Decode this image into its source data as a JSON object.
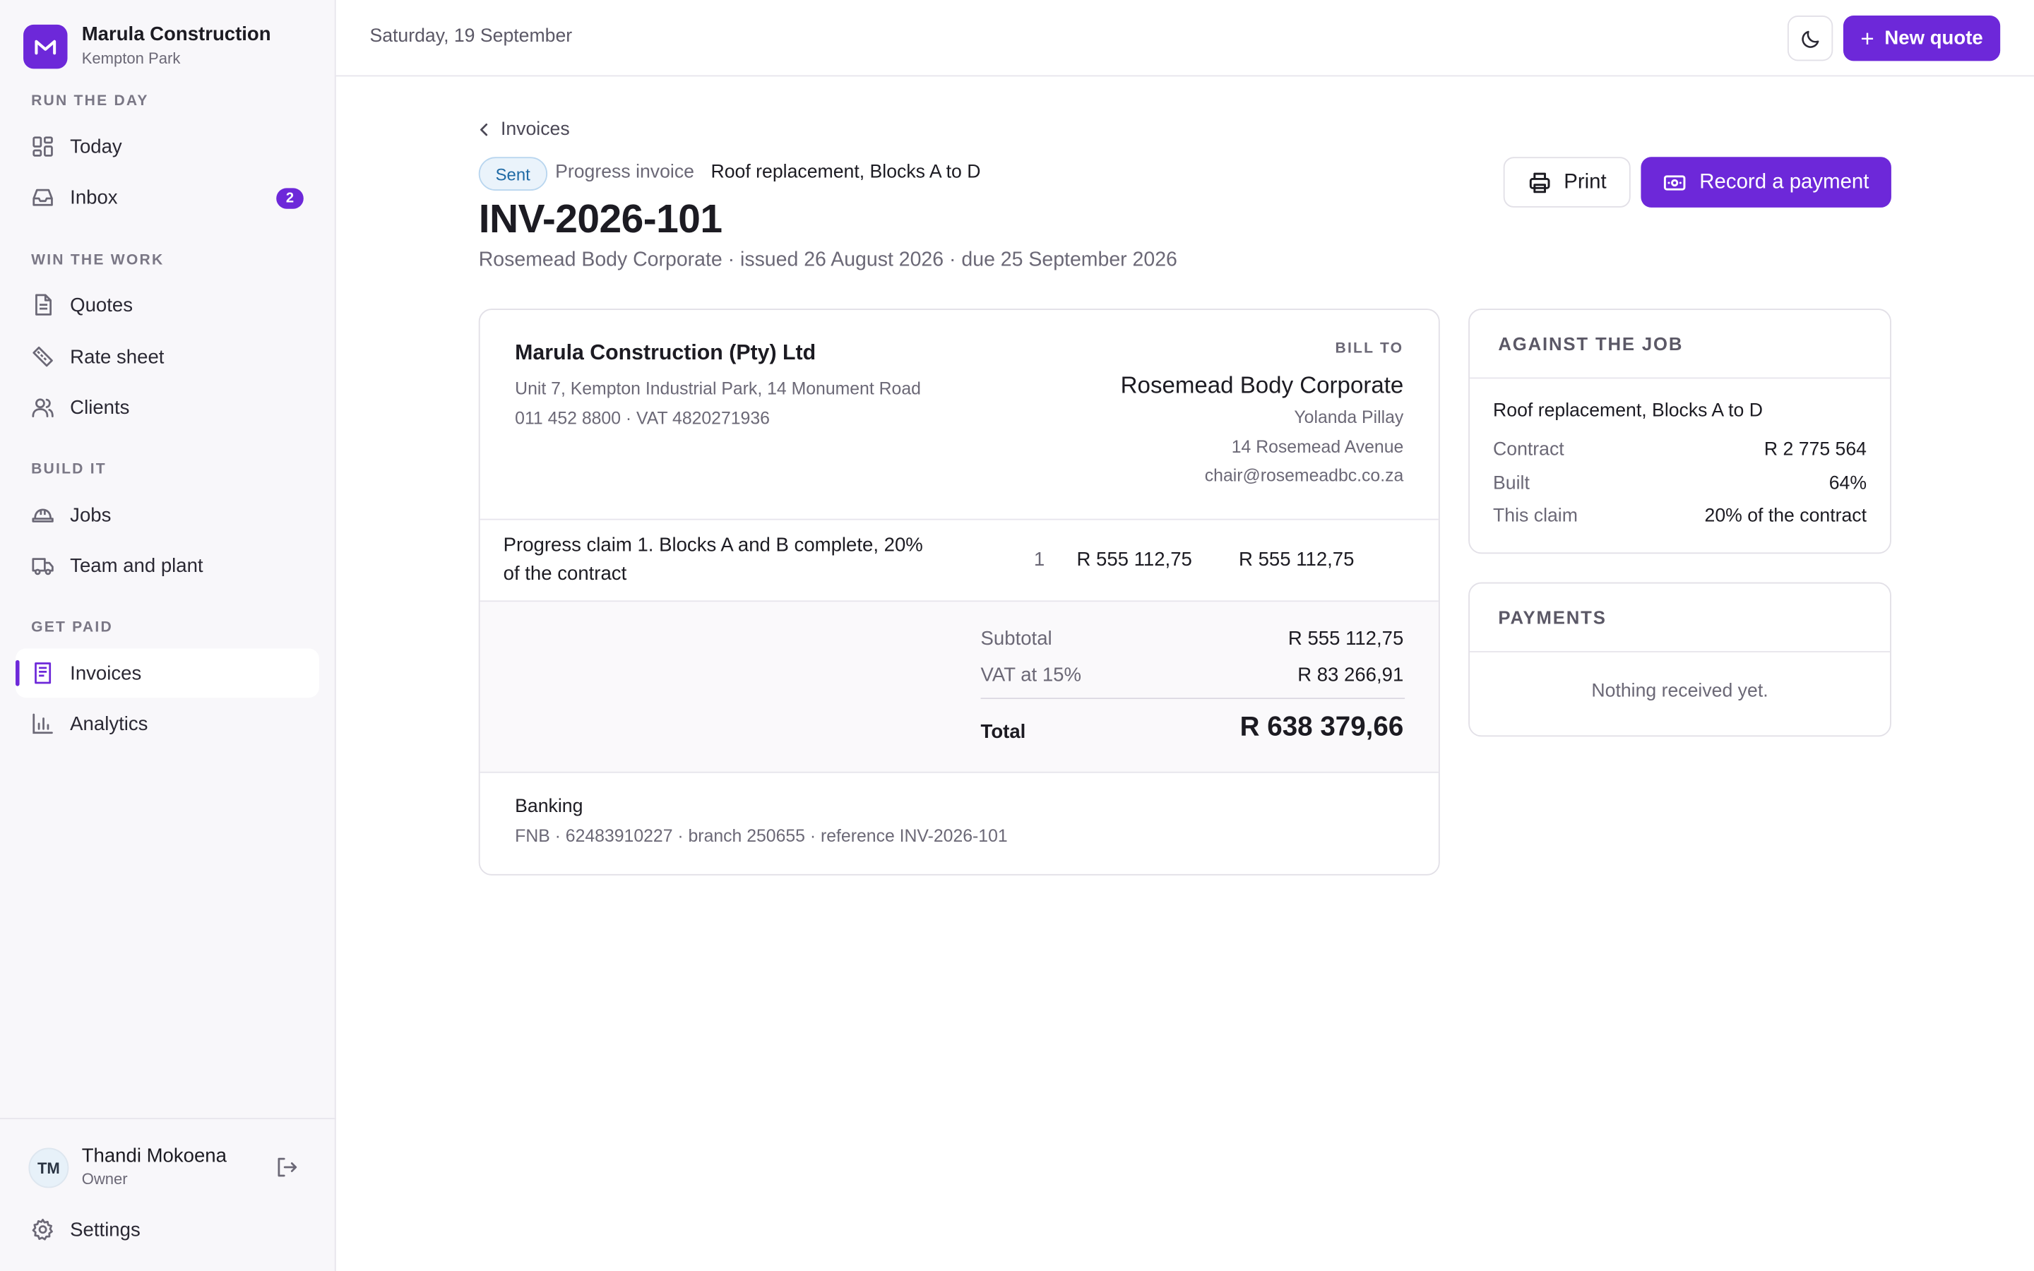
{
  "brand": {
    "name": "Marula Construction",
    "location": "Kempton Park",
    "logo_letter": "M"
  },
  "sidebar": {
    "sections": [
      {
        "label": "RUN THE DAY"
      },
      {
        "label": "WIN THE WORK"
      },
      {
        "label": "BUILD IT"
      },
      {
        "label": "GET PAID"
      }
    ],
    "items": [
      {
        "label": "Today",
        "icon": "dashboard-icon"
      },
      {
        "label": "Inbox",
        "icon": "inbox-icon",
        "badge": "2"
      },
      {
        "label": "Quotes",
        "icon": "document-icon"
      },
      {
        "label": "Rate sheet",
        "icon": "ruler-icon"
      },
      {
        "label": "Clients",
        "icon": "users-icon"
      },
      {
        "label": "Jobs",
        "icon": "hard-hat-icon"
      },
      {
        "label": "Team and plant",
        "icon": "truck-icon"
      },
      {
        "label": "Invoices",
        "icon": "invoice-icon",
        "active": true
      },
      {
        "label": "Analytics",
        "icon": "bar-chart-icon"
      }
    ],
    "user": {
      "initials": "TM",
      "name": "Thandi Mokoena",
      "role": "Owner"
    },
    "settings_label": "Settings"
  },
  "topbar": {
    "date": "Saturday, 19 September",
    "new_quote_label": "New quote"
  },
  "invoice": {
    "breadcrumb": "Invoices",
    "status": "Sent",
    "type": "Progress invoice",
    "job": "Roof replacement, Blocks A to D",
    "number": "INV-2026-101",
    "subtitle": "Rosemead Body Corporate · issued 26 August 2026 · due 25 September 2026",
    "print_label": "Print",
    "record_payment_label": "Record a payment",
    "from": {
      "name": "Marula Construction (Pty) Ltd",
      "address": "Unit 7, Kempton Industrial Park, 14 Monument Road",
      "contact": "011 452 8800 · VAT 4820271936"
    },
    "bill_to": {
      "label": "BILL TO",
      "name": "Rosemead Body Corporate",
      "contact": "Yolanda Pillay",
      "street": "14 Rosemead Avenue",
      "email": "chair@rosemeadbc.co.za"
    },
    "line_items": [
      {
        "description": "Progress claim 1. Blocks A and B complete, 20% of the contract",
        "qty": "1",
        "unit_price": "R 555 112,75",
        "amount": "R 555 112,75"
      }
    ],
    "totals": {
      "subtotal_label": "Subtotal",
      "subtotal": "R 555 112,75",
      "vat_label": "VAT at 15%",
      "vat": "R 83 266,91",
      "total_label": "Total",
      "total": "R 638 379,66"
    },
    "banking": {
      "label": "Banking",
      "details": "FNB · 62483910227 · branch 250655 · reference INV-2026-101"
    }
  },
  "against_job": {
    "heading": "AGAINST THE JOB",
    "title": "Roof replacement, Blocks A to D",
    "rows": [
      {
        "label": "Contract",
        "value": "R 2 775 564"
      },
      {
        "label": "Built",
        "value": "64%"
      },
      {
        "label": "This claim",
        "value": "20% of the contract"
      }
    ]
  },
  "payments": {
    "heading": "PAYMENTS",
    "empty": "Nothing received yet."
  },
  "colors": {
    "accent": "#6d28d9",
    "status_blue": "#1f6aa5"
  }
}
